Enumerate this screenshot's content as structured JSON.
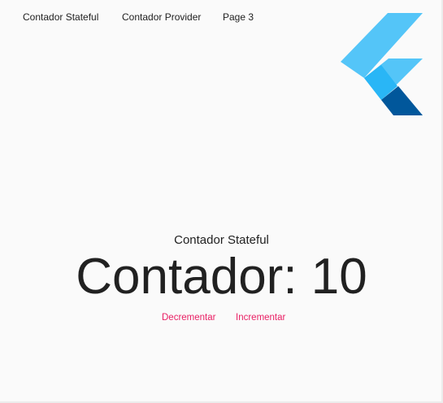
{
  "nav": {
    "items": [
      {
        "label": "Contador Stateful"
      },
      {
        "label": "Contador Provider"
      },
      {
        "label": "Page 3"
      }
    ]
  },
  "logo": {
    "icon": "flutter-logo",
    "colors": {
      "light": "#54c5f8",
      "mid": "#29b6f6",
      "dark": "#01579b"
    }
  },
  "main": {
    "subtitle": "Contador Stateful",
    "counter_text": "Contador: 10",
    "decrement_label": "Decrementar",
    "increment_label": "Incrementar"
  },
  "colors": {
    "accent": "#e91e63",
    "background": "#fafafa",
    "text": "#212121"
  }
}
